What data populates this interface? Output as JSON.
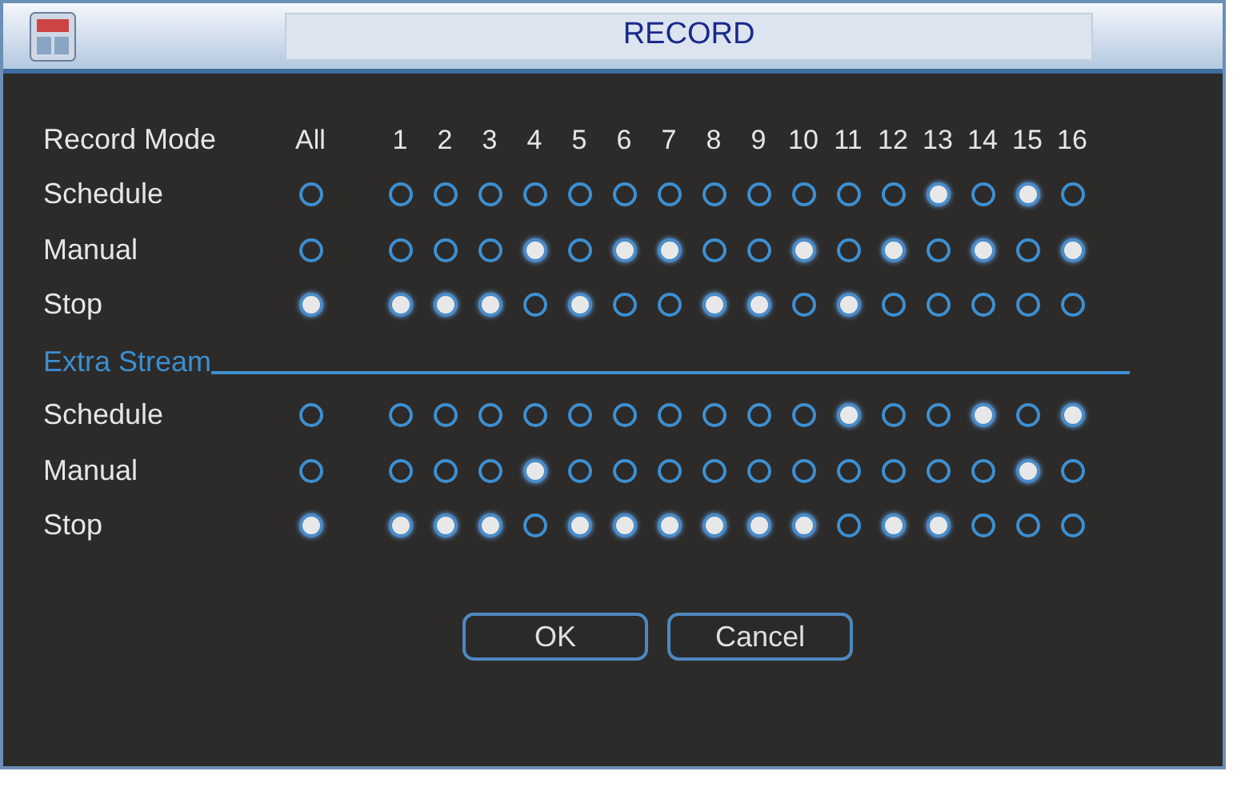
{
  "window": {
    "title": "RECORD"
  },
  "header": {
    "label": "Record Mode",
    "all": "All",
    "channels": [
      "1",
      "2",
      "3",
      "4",
      "5",
      "6",
      "7",
      "8",
      "9",
      "10",
      "11",
      "12",
      "13",
      "14",
      "15",
      "16"
    ]
  },
  "main_stream": [
    {
      "label": "Schedule",
      "all": {
        "selected": false
      },
      "channels": [
        {
          "selected": false
        },
        {
          "selected": false
        },
        {
          "selected": false
        },
        {
          "selected": false
        },
        {
          "selected": false
        },
        {
          "selected": false
        },
        {
          "selected": false
        },
        {
          "selected": false
        },
        {
          "selected": false
        },
        {
          "selected": false
        },
        {
          "selected": false
        },
        {
          "selected": false
        },
        {
          "selected": true
        },
        {
          "selected": false
        },
        {
          "selected": true
        },
        {
          "selected": false
        }
      ]
    },
    {
      "label": "Manual",
      "all": {
        "selected": false
      },
      "channels": [
        {
          "selected": false
        },
        {
          "selected": false
        },
        {
          "selected": false
        },
        {
          "selected": true
        },
        {
          "selected": false
        },
        {
          "selected": true
        },
        {
          "selected": true
        },
        {
          "selected": false
        },
        {
          "selected": false
        },
        {
          "selected": true
        },
        {
          "selected": false
        },
        {
          "selected": true
        },
        {
          "selected": false
        },
        {
          "selected": true
        },
        {
          "selected": false
        },
        {
          "selected": true
        }
      ]
    },
    {
      "label": "Stop",
      "all": {
        "selected": true
      },
      "channels": [
        {
          "selected": true
        },
        {
          "selected": true
        },
        {
          "selected": true
        },
        {
          "selected": false
        },
        {
          "selected": true
        },
        {
          "selected": false
        },
        {
          "selected": false
        },
        {
          "selected": true
        },
        {
          "selected": true
        },
        {
          "selected": false
        },
        {
          "selected": true
        },
        {
          "selected": false
        },
        {
          "selected": false
        },
        {
          "selected": false
        },
        {
          "selected": false
        },
        {
          "selected": false
        }
      ]
    }
  ],
  "extra_stream": {
    "title": "Extra Stream",
    "rows": [
      {
        "label": "Schedule",
        "all": {
          "selected": false
        },
        "channels": [
          {
            "selected": false
          },
          {
            "selected": false
          },
          {
            "selected": false
          },
          {
            "selected": false
          },
          {
            "selected": false
          },
          {
            "selected": false
          },
          {
            "selected": false
          },
          {
            "selected": false
          },
          {
            "selected": false
          },
          {
            "selected": false
          },
          {
            "selected": true
          },
          {
            "selected": false
          },
          {
            "selected": false
          },
          {
            "selected": true
          },
          {
            "selected": false
          },
          {
            "selected": true
          }
        ]
      },
      {
        "label": "Manual",
        "all": {
          "selected": false
        },
        "channels": [
          {
            "selected": false
          },
          {
            "selected": false
          },
          {
            "selected": false
          },
          {
            "selected": true
          },
          {
            "selected": false
          },
          {
            "selected": false
          },
          {
            "selected": false
          },
          {
            "selected": false
          },
          {
            "selected": false
          },
          {
            "selected": false
          },
          {
            "selected": false
          },
          {
            "selected": false
          },
          {
            "selected": false
          },
          {
            "selected": false
          },
          {
            "selected": true
          },
          {
            "selected": false
          }
        ]
      },
      {
        "label": "Stop",
        "all": {
          "selected": true
        },
        "channels": [
          {
            "selected": true
          },
          {
            "selected": true
          },
          {
            "selected": true
          },
          {
            "selected": false
          },
          {
            "selected": true
          },
          {
            "selected": true
          },
          {
            "selected": true
          },
          {
            "selected": true
          },
          {
            "selected": true
          },
          {
            "selected": true
          },
          {
            "selected": false
          },
          {
            "selected": true
          },
          {
            "selected": true
          },
          {
            "selected": false
          },
          {
            "selected": false
          },
          {
            "selected": false
          }
        ]
      }
    ]
  },
  "buttons": [
    "OK",
    "Cancel"
  ]
}
